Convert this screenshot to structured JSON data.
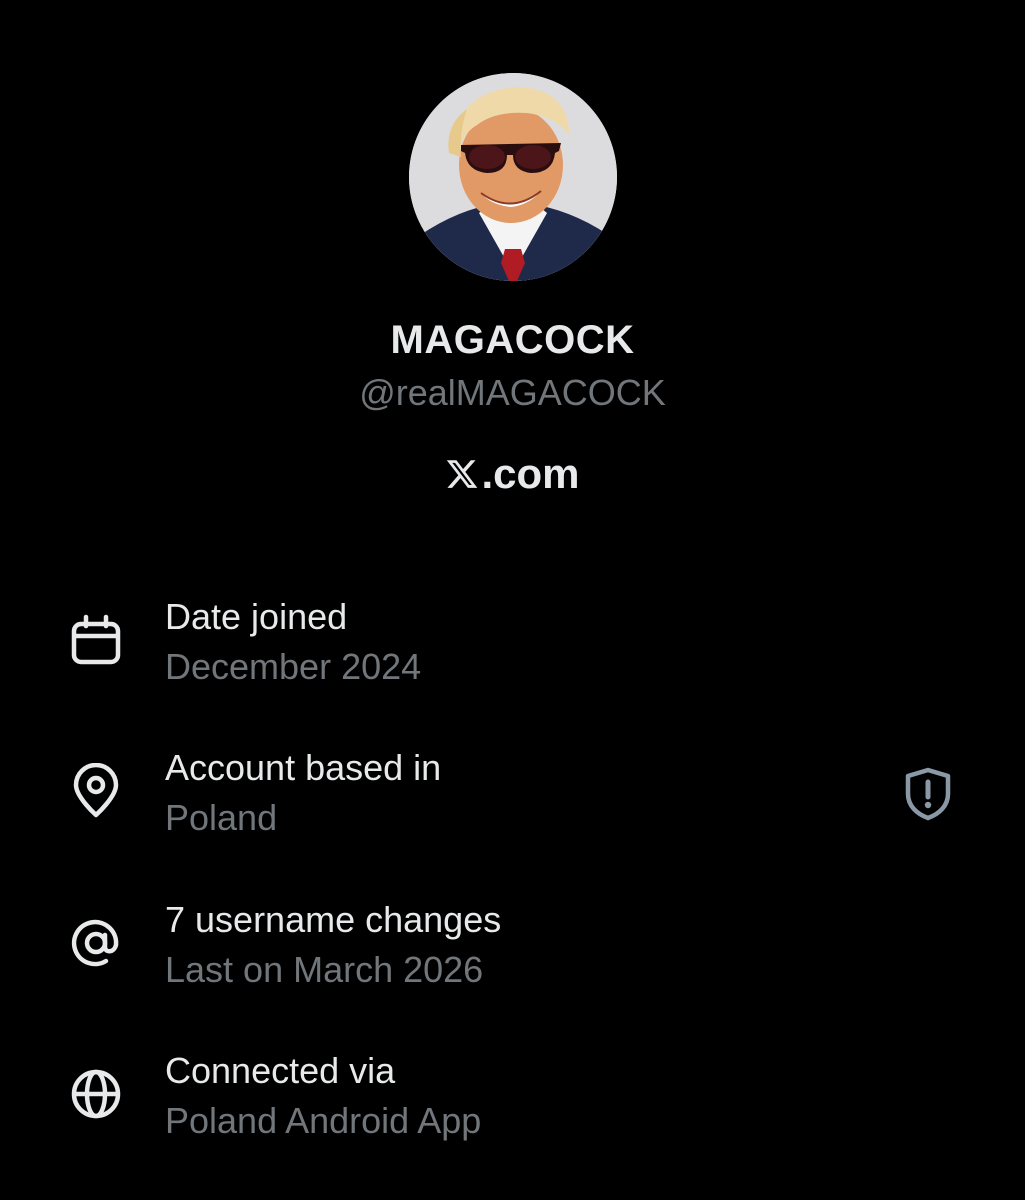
{
  "profile": {
    "display_name": "MAGACOCK",
    "handle": "@realMAGACOCK",
    "avatar": "profile-photo-avatar"
  },
  "brand": {
    "icon": "x-logo-icon",
    "text": ".com"
  },
  "details": [
    {
      "icon": "calendar-icon",
      "title": "Date joined",
      "value": "December 2024"
    },
    {
      "icon": "location-pin-icon",
      "title": "Account based in",
      "value": "Poland"
    },
    {
      "icon": "at-sign-icon",
      "title": "7 username changes",
      "value": "Last on March 2026"
    },
    {
      "icon": "globe-icon",
      "title": "Connected via",
      "value": "Poland Android App"
    }
  ],
  "colors": {
    "background": "#000000",
    "primary_text": "#e7e9ea",
    "secondary_text": "#71767b"
  }
}
